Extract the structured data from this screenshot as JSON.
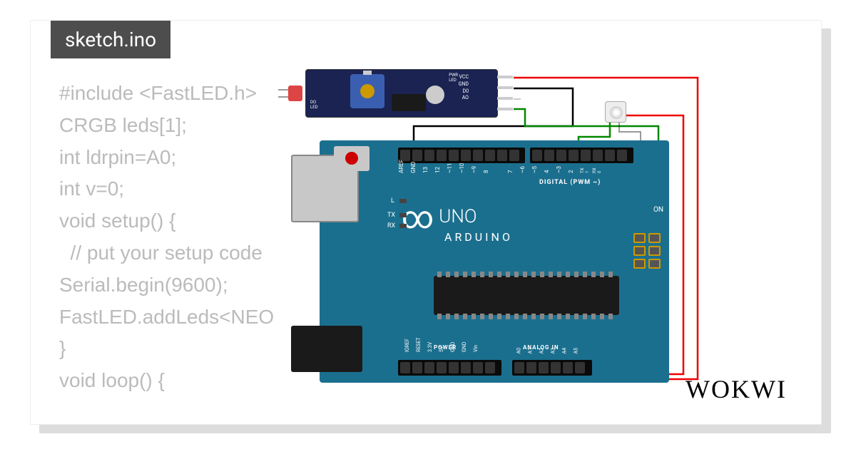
{
  "tab": {
    "filename": "sketch.ino"
  },
  "code": {
    "lines": [
      "#include <FastLED.h>",
      "CRGB leds[1];",
      "int ldrpin=A0;",
      "int v=0;",
      "void setup() {",
      "  // put your setup code",
      "Serial.begin(9600);",
      "FastLED.addLeds<NEO",
      "}",
      "void loop() {"
    ]
  },
  "board": {
    "name": "UNO",
    "brand": "ARDUINO",
    "digital_section": "DIGITAL (PWM ~)",
    "power_section": "POWER",
    "analog_section": "ANALOG IN",
    "pins_top": [
      "AREF",
      "GND",
      "13",
      "12",
      "~11",
      "~10",
      "~9",
      "8",
      "7",
      "~6",
      "~5",
      "4",
      "~3",
      "2",
      "TX 1",
      "RX 0"
    ],
    "pins_bottom_power": [
      "IOREF",
      "RESET",
      "3.3V",
      "5V",
      "GND",
      "GND",
      "Vin"
    ],
    "pins_bottom_analog": [
      "A0",
      "A1",
      "A2",
      "A3",
      "A4",
      "A5"
    ],
    "led_labels": {
      "l": "L",
      "tx": "TX",
      "rx": "RX",
      "on": "ON"
    }
  },
  "ldr_module": {
    "pins": [
      "VCC",
      "GND",
      "D0",
      "AO"
    ],
    "pwr_led": "PWR\nLED",
    "do_led": "DO\nLED"
  },
  "logo": "WOKWI",
  "wires": [
    {
      "color": "#008000",
      "from": "ldr.AO",
      "to": "arduino.A0"
    },
    {
      "color": "#000000",
      "from": "ldr.GND",
      "to": "arduino.GND"
    },
    {
      "color": "#ff0000",
      "from": "ldr.VCC",
      "to": "arduino.5V"
    },
    {
      "color": "#008000",
      "from": "neopixel.DIN",
      "to": "arduino.D3"
    },
    {
      "color": "#ff0000",
      "from": "neopixel.VCC",
      "to": "arduino.5V"
    },
    {
      "color": "#000000",
      "from": "neopixel.GND",
      "to": "arduino.GND"
    }
  ]
}
